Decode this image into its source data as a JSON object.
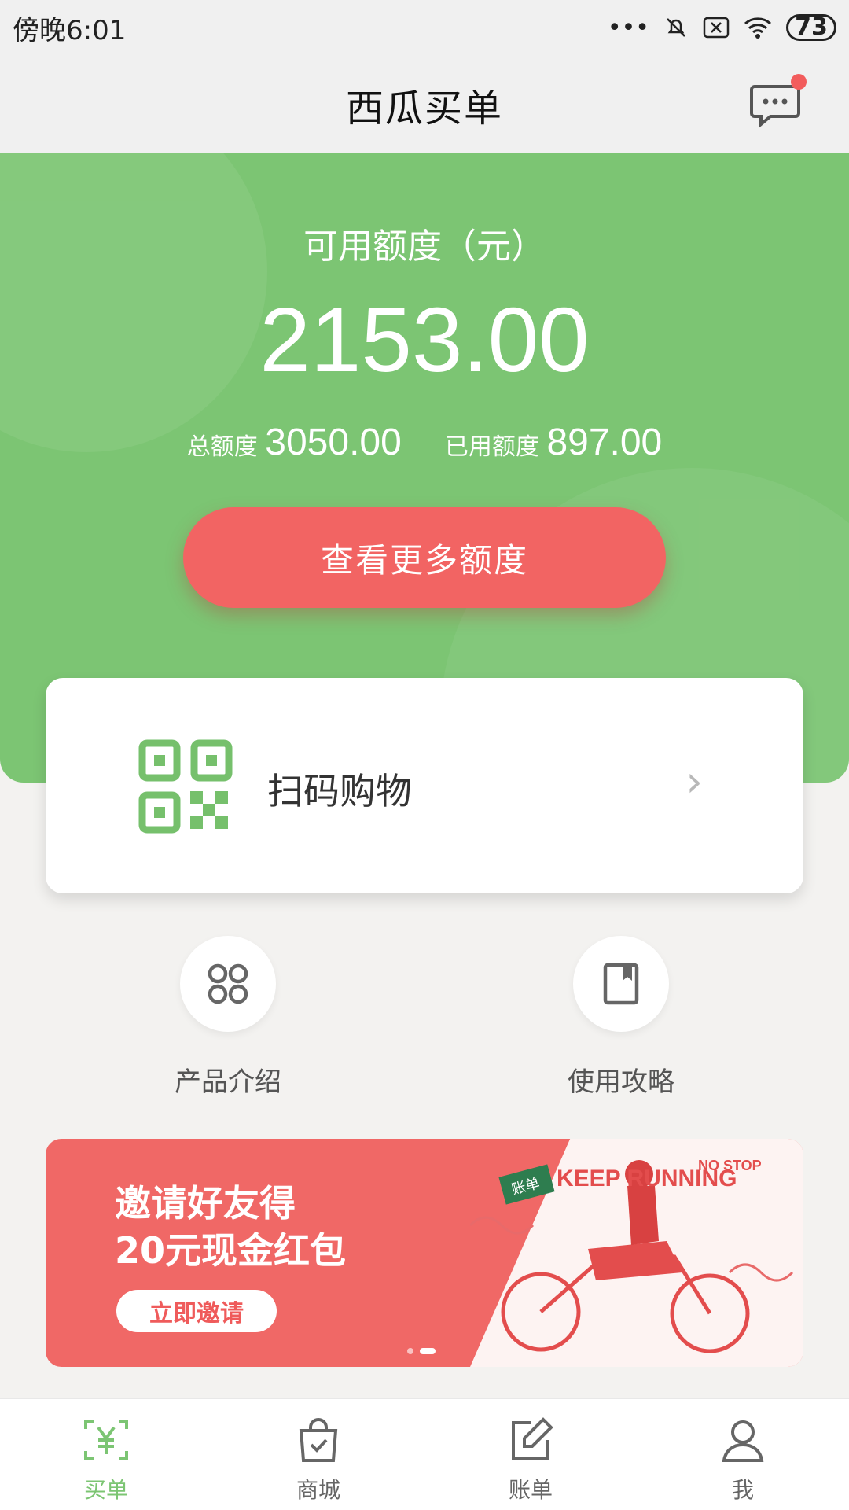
{
  "status_bar": {
    "time": "傍晚6:01",
    "battery": "73"
  },
  "header": {
    "title": "西瓜买单"
  },
  "credit": {
    "available_label": "可用额度（元）",
    "available_amount": "2153.00",
    "total_label": "总额度",
    "total_amount": "3050.00",
    "used_label": "已用额度",
    "used_amount": "897.00",
    "more_button": "查看更多额度"
  },
  "scan": {
    "label": "扫码购物"
  },
  "shortcuts": [
    {
      "label": "产品介绍",
      "icon": "grid-icon"
    },
    {
      "label": "使用攻略",
      "icon": "bookmark-book-icon"
    }
  ],
  "banner": {
    "line1": "邀请好友得",
    "line2": "20元现金红包",
    "button": "立即邀请",
    "art_text1": "KEEP RUNNING",
    "art_text2": "NO STOP",
    "art_tag": "账单"
  },
  "tabs": [
    {
      "label": "买单",
      "icon": "yuan-scan-icon",
      "active": true
    },
    {
      "label": "商城",
      "icon": "shopping-bag-icon",
      "active": false
    },
    {
      "label": "账单",
      "icon": "edit-bill-icon",
      "active": false
    },
    {
      "label": "我",
      "icon": "user-icon",
      "active": false
    }
  ],
  "colors": {
    "primary_green": "#7cc573",
    "accent_red": "#f26463"
  }
}
